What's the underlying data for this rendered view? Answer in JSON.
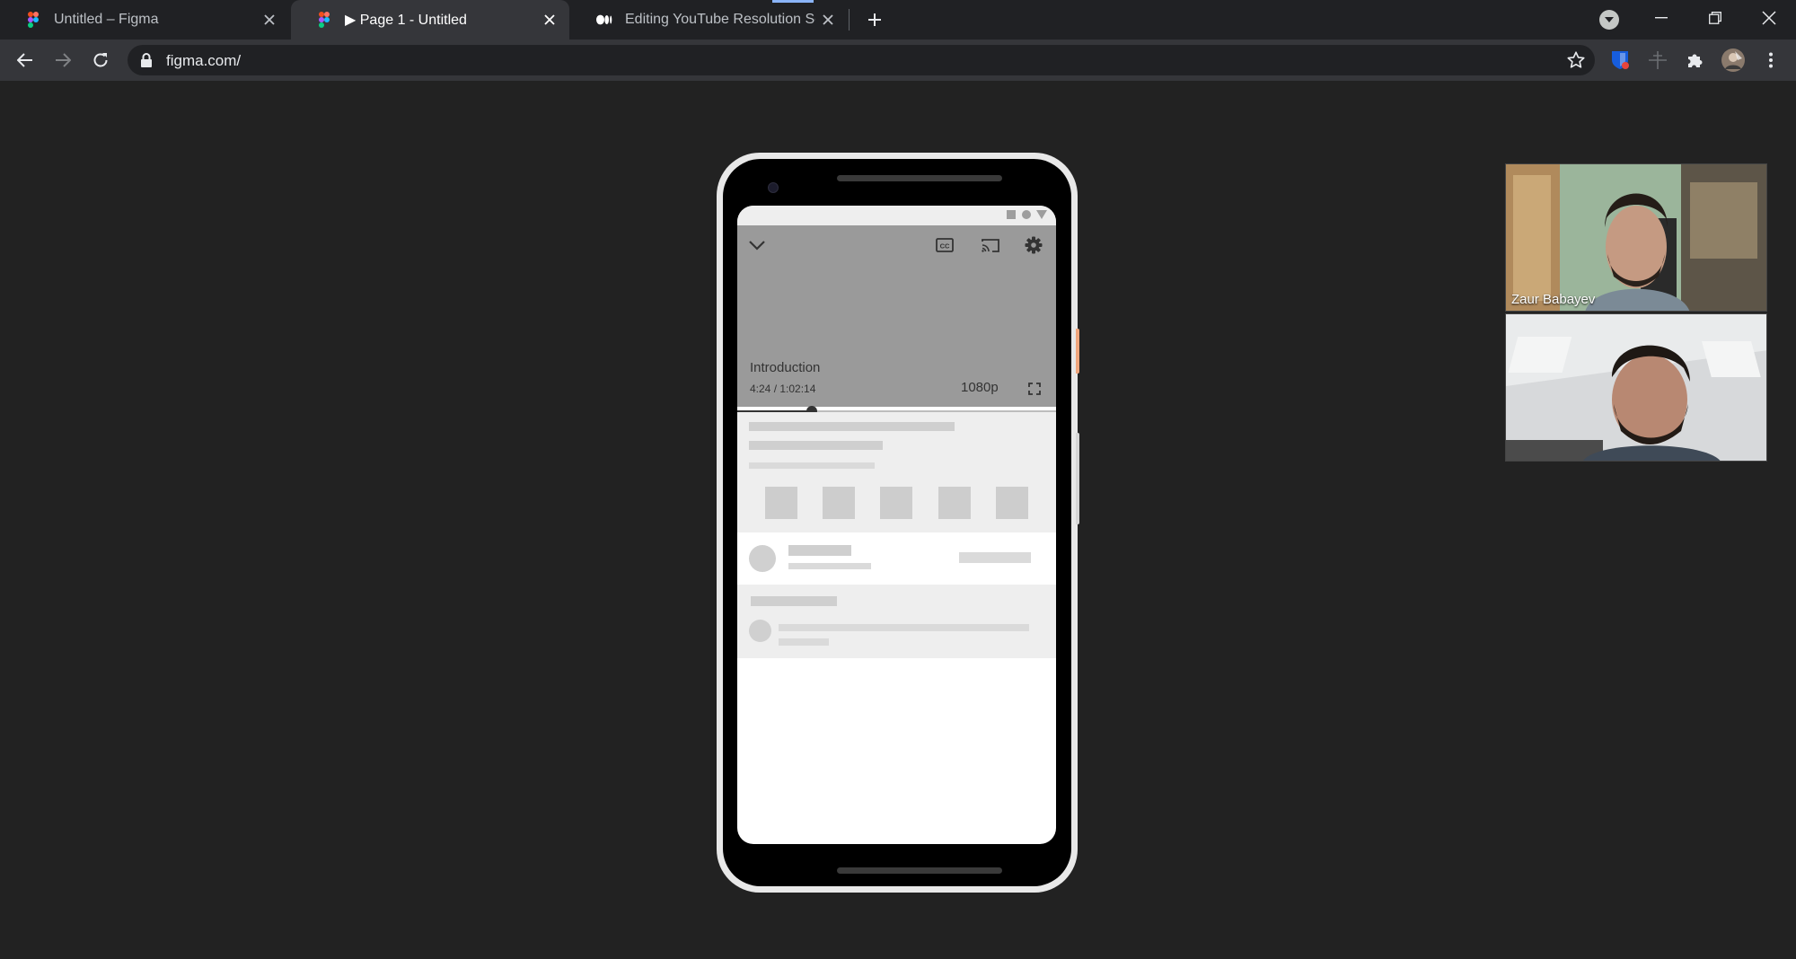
{
  "browser": {
    "tabs": [
      {
        "title": "Untitled – Figma",
        "active": false,
        "favicon": "figma-icon"
      },
      {
        "title": "▶ Page 1 - Untitled",
        "active": true,
        "favicon": "figma-icon"
      },
      {
        "title": "Editing YouTube Resolution Setti",
        "active": false,
        "favicon": "medium-icon"
      }
    ],
    "url": "figma.com/"
  },
  "prototype": {
    "video": {
      "title": "Introduction",
      "time": "4:24 / 1:02:14",
      "resolution": "1080p",
      "progress_fraction": 0.233
    },
    "icons": [
      "chevron-down-icon",
      "captions-icon",
      "cast-icon",
      "settings-icon",
      "fullscreen-icon"
    ]
  },
  "call": {
    "participants": [
      {
        "name": "Zaur Babayev"
      },
      {
        "name": ""
      }
    ]
  },
  "colors": {
    "page_bg": "#222222",
    "tab_strip": "#202124",
    "toolbar": "#35363a",
    "video_bg": "#9a9a9a",
    "placeholder": "#cfcfcf"
  }
}
